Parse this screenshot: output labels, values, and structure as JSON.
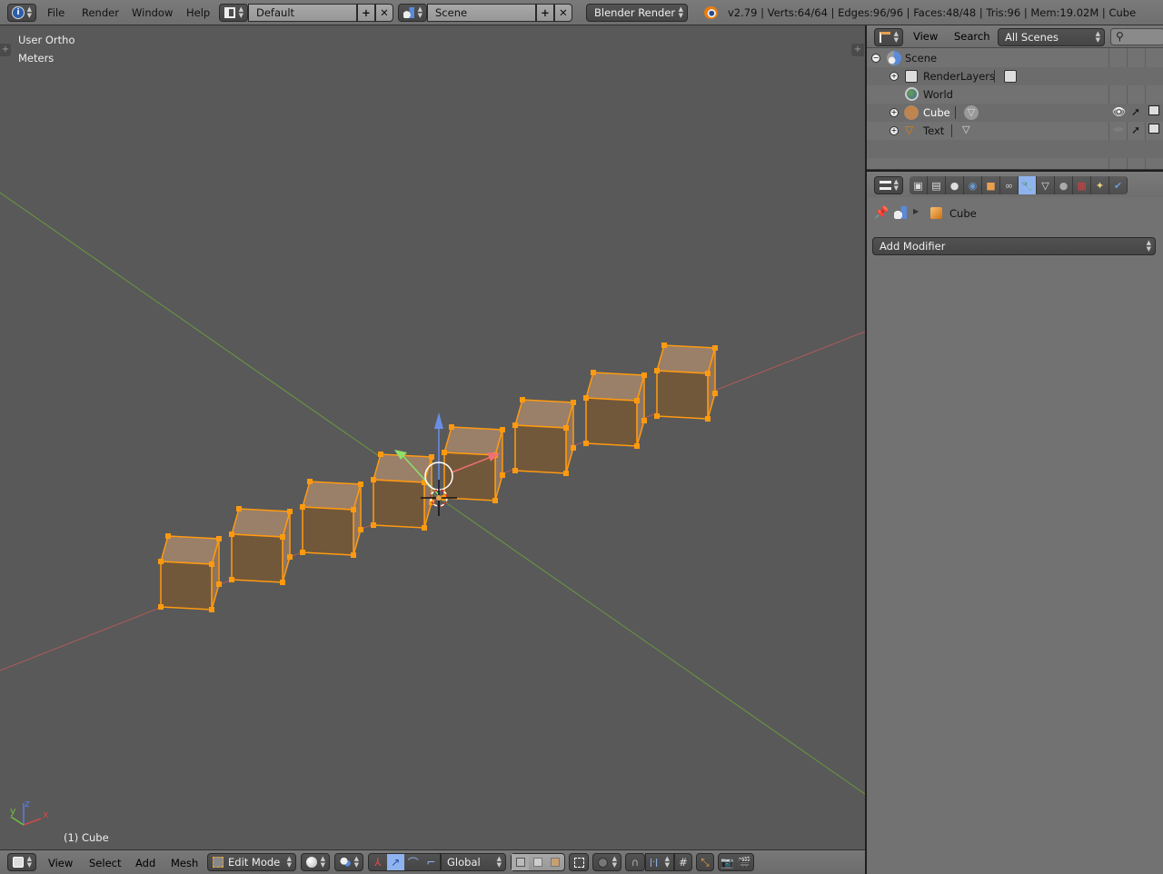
{
  "top_header": {
    "menu": [
      "File",
      "Render",
      "Window",
      "Help"
    ],
    "layout_name": "Default",
    "scene_name": "Scene",
    "render_engine": "Blender Render",
    "stats": "v2.79 | Verts:64/64 | Edges:96/96 | Faces:48/48 | Tris:96 | Mem:19.02M | Cube"
  },
  "viewport": {
    "view_name": "User Ortho",
    "units": "Meters",
    "object_label": "(1) Cube",
    "axis_labels": {
      "x": "x",
      "y": "y",
      "z": "z"
    },
    "colors": {
      "bg": "#595959",
      "x_axis": "#c06060",
      "y_axis": "#6a9a40",
      "select": "#ff9a10",
      "cube_top": "#9a7f69",
      "cube_front": "#72583a",
      "cube_side": "#8c7563"
    },
    "cube_count": 8
  },
  "viewport_footer": {
    "menu": [
      "View",
      "Select",
      "Add",
      "Mesh"
    ],
    "mode": "Edit Mode",
    "orientation": "Global"
  },
  "outliner": {
    "menu": [
      "View",
      "Search"
    ],
    "filter": "All Scenes",
    "items": [
      {
        "label": "Scene",
        "icon": "scene-icon"
      },
      {
        "label": "RenderLayers",
        "icon": "render-layers-icon"
      },
      {
        "label": "World",
        "icon": "world-icon"
      },
      {
        "label": "Cube",
        "icon": "mesh-object-icon",
        "visible": true
      },
      {
        "label": "Text",
        "icon": "mesh-object-icon",
        "visible": false
      }
    ]
  },
  "properties": {
    "context_object": "Cube",
    "add_modifier_label": "Add Modifier",
    "active_tab": "modifiers"
  }
}
